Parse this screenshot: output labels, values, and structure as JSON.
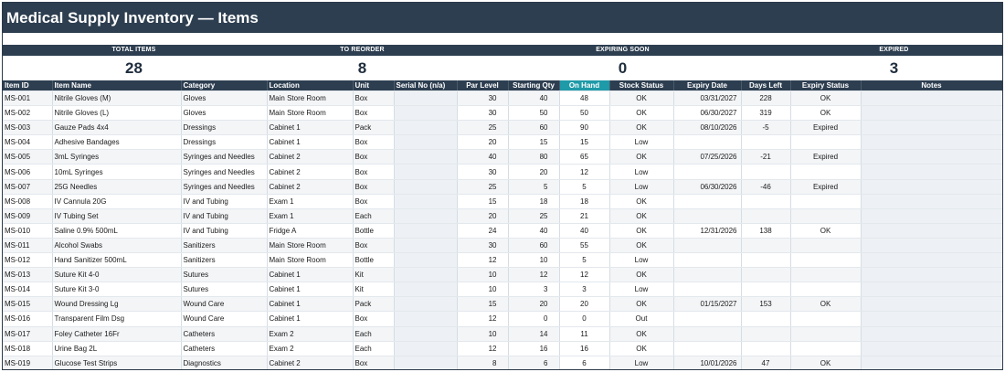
{
  "title": "Medical Supply Inventory — Items",
  "kpis": [
    {
      "label": "TOTAL ITEMS",
      "value": "28"
    },
    {
      "label": "TO REORDER",
      "value": "8"
    },
    {
      "label": "EXPIRING SOON",
      "value": "0"
    },
    {
      "label": "EXPIRED",
      "value": "3"
    }
  ],
  "columns": [
    "Item ID",
    "Item Name",
    "Category",
    "Location",
    "Unit",
    "Serial No (n/a)",
    "Par Level",
    "Starting Qty",
    "On Hand",
    "Stock Status",
    "Expiry Date",
    "Days Left",
    "Expiry Status",
    "Notes"
  ],
  "colors": {
    "header_bg": "#2d3e50",
    "on_hand_header": "#1e9aa8"
  },
  "rows": [
    {
      "id": "MS-001",
      "name": "Nitrile Gloves (M)",
      "category": "Gloves",
      "location": "Main Store Room",
      "unit": "Box",
      "serial": "",
      "par": "30",
      "start": "40",
      "onhand": "48",
      "stock": "OK",
      "expiry": "03/31/2027",
      "days": "228",
      "exp_status": "OK",
      "notes": ""
    },
    {
      "id": "MS-002",
      "name": "Nitrile Gloves (L)",
      "category": "Gloves",
      "location": "Main Store Room",
      "unit": "Box",
      "serial": "",
      "par": "30",
      "start": "50",
      "onhand": "50",
      "stock": "OK",
      "expiry": "06/30/2027",
      "days": "319",
      "exp_status": "OK",
      "notes": ""
    },
    {
      "id": "MS-003",
      "name": "Gauze Pads 4x4",
      "category": "Dressings",
      "location": "Cabinet 1",
      "unit": "Pack",
      "serial": "",
      "par": "25",
      "start": "60",
      "onhand": "90",
      "stock": "OK",
      "expiry": "08/10/2026",
      "days": "-5",
      "exp_status": "Expired",
      "notes": ""
    },
    {
      "id": "MS-004",
      "name": "Adhesive Bandages",
      "category": "Dressings",
      "location": "Cabinet 1",
      "unit": "Box",
      "serial": "",
      "par": "20",
      "start": "15",
      "onhand": "15",
      "stock": "Low",
      "expiry": "",
      "days": "",
      "exp_status": "",
      "notes": ""
    },
    {
      "id": "MS-005",
      "name": "3mL Syringes",
      "category": "Syringes and Needles",
      "location": "Cabinet 2",
      "unit": "Box",
      "serial": "",
      "par": "40",
      "start": "80",
      "onhand": "65",
      "stock": "OK",
      "expiry": "07/25/2026",
      "days": "-21",
      "exp_status": "Expired",
      "notes": ""
    },
    {
      "id": "MS-006",
      "name": "10mL Syringes",
      "category": "Syringes and Needles",
      "location": "Cabinet 2",
      "unit": "Box",
      "serial": "",
      "par": "30",
      "start": "20",
      "onhand": "12",
      "stock": "Low",
      "expiry": "",
      "days": "",
      "exp_status": "",
      "notes": ""
    },
    {
      "id": "MS-007",
      "name": "25G Needles",
      "category": "Syringes and Needles",
      "location": "Cabinet 2",
      "unit": "Box",
      "serial": "",
      "par": "25",
      "start": "5",
      "onhand": "5",
      "stock": "Low",
      "expiry": "06/30/2026",
      "days": "-46",
      "exp_status": "Expired",
      "notes": ""
    },
    {
      "id": "MS-008",
      "name": "IV Cannula 20G",
      "category": "IV and Tubing",
      "location": "Exam 1",
      "unit": "Box",
      "serial": "",
      "par": "15",
      "start": "18",
      "onhand": "18",
      "stock": "OK",
      "expiry": "",
      "days": "",
      "exp_status": "",
      "notes": ""
    },
    {
      "id": "MS-009",
      "name": "IV Tubing Set",
      "category": "IV and Tubing",
      "location": "Exam 1",
      "unit": "Each",
      "serial": "",
      "par": "20",
      "start": "25",
      "onhand": "21",
      "stock": "OK",
      "expiry": "",
      "days": "",
      "exp_status": "",
      "notes": ""
    },
    {
      "id": "MS-010",
      "name": "Saline 0.9% 500mL",
      "category": "IV and Tubing",
      "location": "Fridge A",
      "unit": "Bottle",
      "serial": "",
      "par": "24",
      "start": "40",
      "onhand": "40",
      "stock": "OK",
      "expiry": "12/31/2026",
      "days": "138",
      "exp_status": "OK",
      "notes": ""
    },
    {
      "id": "MS-011",
      "name": "Alcohol Swabs",
      "category": "Sanitizers",
      "location": "Main Store Room",
      "unit": "Box",
      "serial": "",
      "par": "30",
      "start": "60",
      "onhand": "55",
      "stock": "OK",
      "expiry": "",
      "days": "",
      "exp_status": "",
      "notes": ""
    },
    {
      "id": "MS-012",
      "name": "Hand Sanitizer 500mL",
      "category": "Sanitizers",
      "location": "Main Store Room",
      "unit": "Bottle",
      "serial": "",
      "par": "12",
      "start": "10",
      "onhand": "5",
      "stock": "Low",
      "expiry": "",
      "days": "",
      "exp_status": "",
      "notes": ""
    },
    {
      "id": "MS-013",
      "name": "Suture Kit 4-0",
      "category": "Sutures",
      "location": "Cabinet 1",
      "unit": "Kit",
      "serial": "",
      "par": "10",
      "start": "12",
      "onhand": "12",
      "stock": "OK",
      "expiry": "",
      "days": "",
      "exp_status": "",
      "notes": ""
    },
    {
      "id": "MS-014",
      "name": "Suture Kit 3-0",
      "category": "Sutures",
      "location": "Cabinet 1",
      "unit": "Kit",
      "serial": "",
      "par": "10",
      "start": "3",
      "onhand": "3",
      "stock": "Low",
      "expiry": "",
      "days": "",
      "exp_status": "",
      "notes": ""
    },
    {
      "id": "MS-015",
      "name": "Wound Dressing Lg",
      "category": "Wound Care",
      "location": "Cabinet 1",
      "unit": "Pack",
      "serial": "",
      "par": "15",
      "start": "20",
      "onhand": "20",
      "stock": "OK",
      "expiry": "01/15/2027",
      "days": "153",
      "exp_status": "OK",
      "notes": ""
    },
    {
      "id": "MS-016",
      "name": "Transparent Film Dsg",
      "category": "Wound Care",
      "location": "Cabinet 1",
      "unit": "Box",
      "serial": "",
      "par": "12",
      "start": "0",
      "onhand": "0",
      "stock": "Out",
      "expiry": "",
      "days": "",
      "exp_status": "",
      "notes": ""
    },
    {
      "id": "MS-017",
      "name": "Foley Catheter 16Fr",
      "category": "Catheters",
      "location": "Exam 2",
      "unit": "Each",
      "serial": "",
      "par": "10",
      "start": "14",
      "onhand": "11",
      "stock": "OK",
      "expiry": "",
      "days": "",
      "exp_status": "",
      "notes": ""
    },
    {
      "id": "MS-018",
      "name": "Urine Bag 2L",
      "category": "Catheters",
      "location": "Exam 2",
      "unit": "Each",
      "serial": "",
      "par": "12",
      "start": "16",
      "onhand": "16",
      "stock": "OK",
      "expiry": "",
      "days": "",
      "exp_status": "",
      "notes": ""
    },
    {
      "id": "MS-019",
      "name": "Glucose Test Strips",
      "category": "Diagnostics",
      "location": "Cabinet 2",
      "unit": "Box",
      "serial": "",
      "par": "8",
      "start": "6",
      "onhand": "6",
      "stock": "Low",
      "expiry": "10/01/2026",
      "days": "47",
      "exp_status": "OK",
      "notes": ""
    }
  ]
}
